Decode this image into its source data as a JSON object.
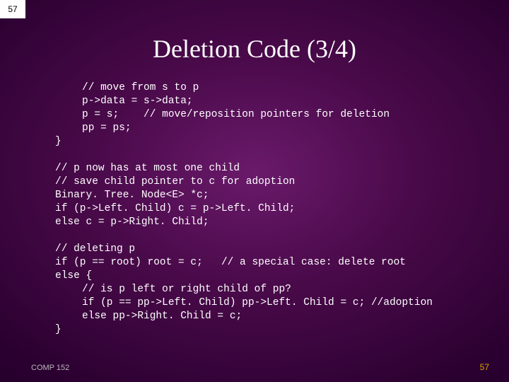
{
  "slide": {
    "number_top": "57",
    "title": "Deletion Code (3/4)",
    "footer_left": "COMP 152",
    "footer_right": "57"
  },
  "code": {
    "l1": "// move from s to p",
    "l2": "p->data = s->data;",
    "l3": "p = s;    // move/reposition pointers for deletion",
    "l4": "pp = ps;",
    "l5": "}",
    "l6": "",
    "l7": "// p now has at most one child",
    "l8": "// save child pointer to c for adoption",
    "l9": "Binary. Tree. Node<E> *c;",
    "l10": "if (p->Left. Child) c = p->Left. Child;",
    "l11": "else c = p->Right. Child;",
    "l12": "",
    "l13": "// deleting p",
    "l14": "if (p == root) root = c;   // a special case: delete root",
    "l15": "else {",
    "l16": "// is p left or right child of pp?",
    "l17": "if (p == pp->Left. Child) pp->Left. Child = c; //adoption",
    "l18": "else pp->Right. Child = c;",
    "l19": "}"
  }
}
